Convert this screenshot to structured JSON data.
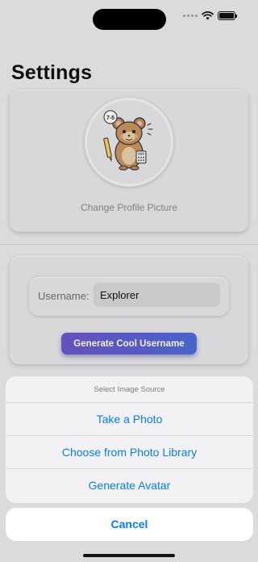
{
  "screen": {
    "title": "Settings"
  },
  "status_bar": {
    "icons": [
      "cellular-icon",
      "wifi-icon",
      "battery-icon"
    ]
  },
  "profile": {
    "change_label": "Change Profile Picture",
    "avatar_badge": "7-5"
  },
  "username": {
    "label": "Username:",
    "value": "Explorer",
    "generate_label": "Generate Cool Username"
  },
  "action_sheet": {
    "title": "Select Image Source",
    "options": [
      "Take a Photo",
      "Choose from Photo Library",
      "Generate Avatar"
    ],
    "cancel_label": "Cancel"
  },
  "colors": {
    "accent": "#0a7cf5",
    "button_gradient_start": "#6b57c7",
    "button_gradient_end": "#4e6bd8"
  }
}
